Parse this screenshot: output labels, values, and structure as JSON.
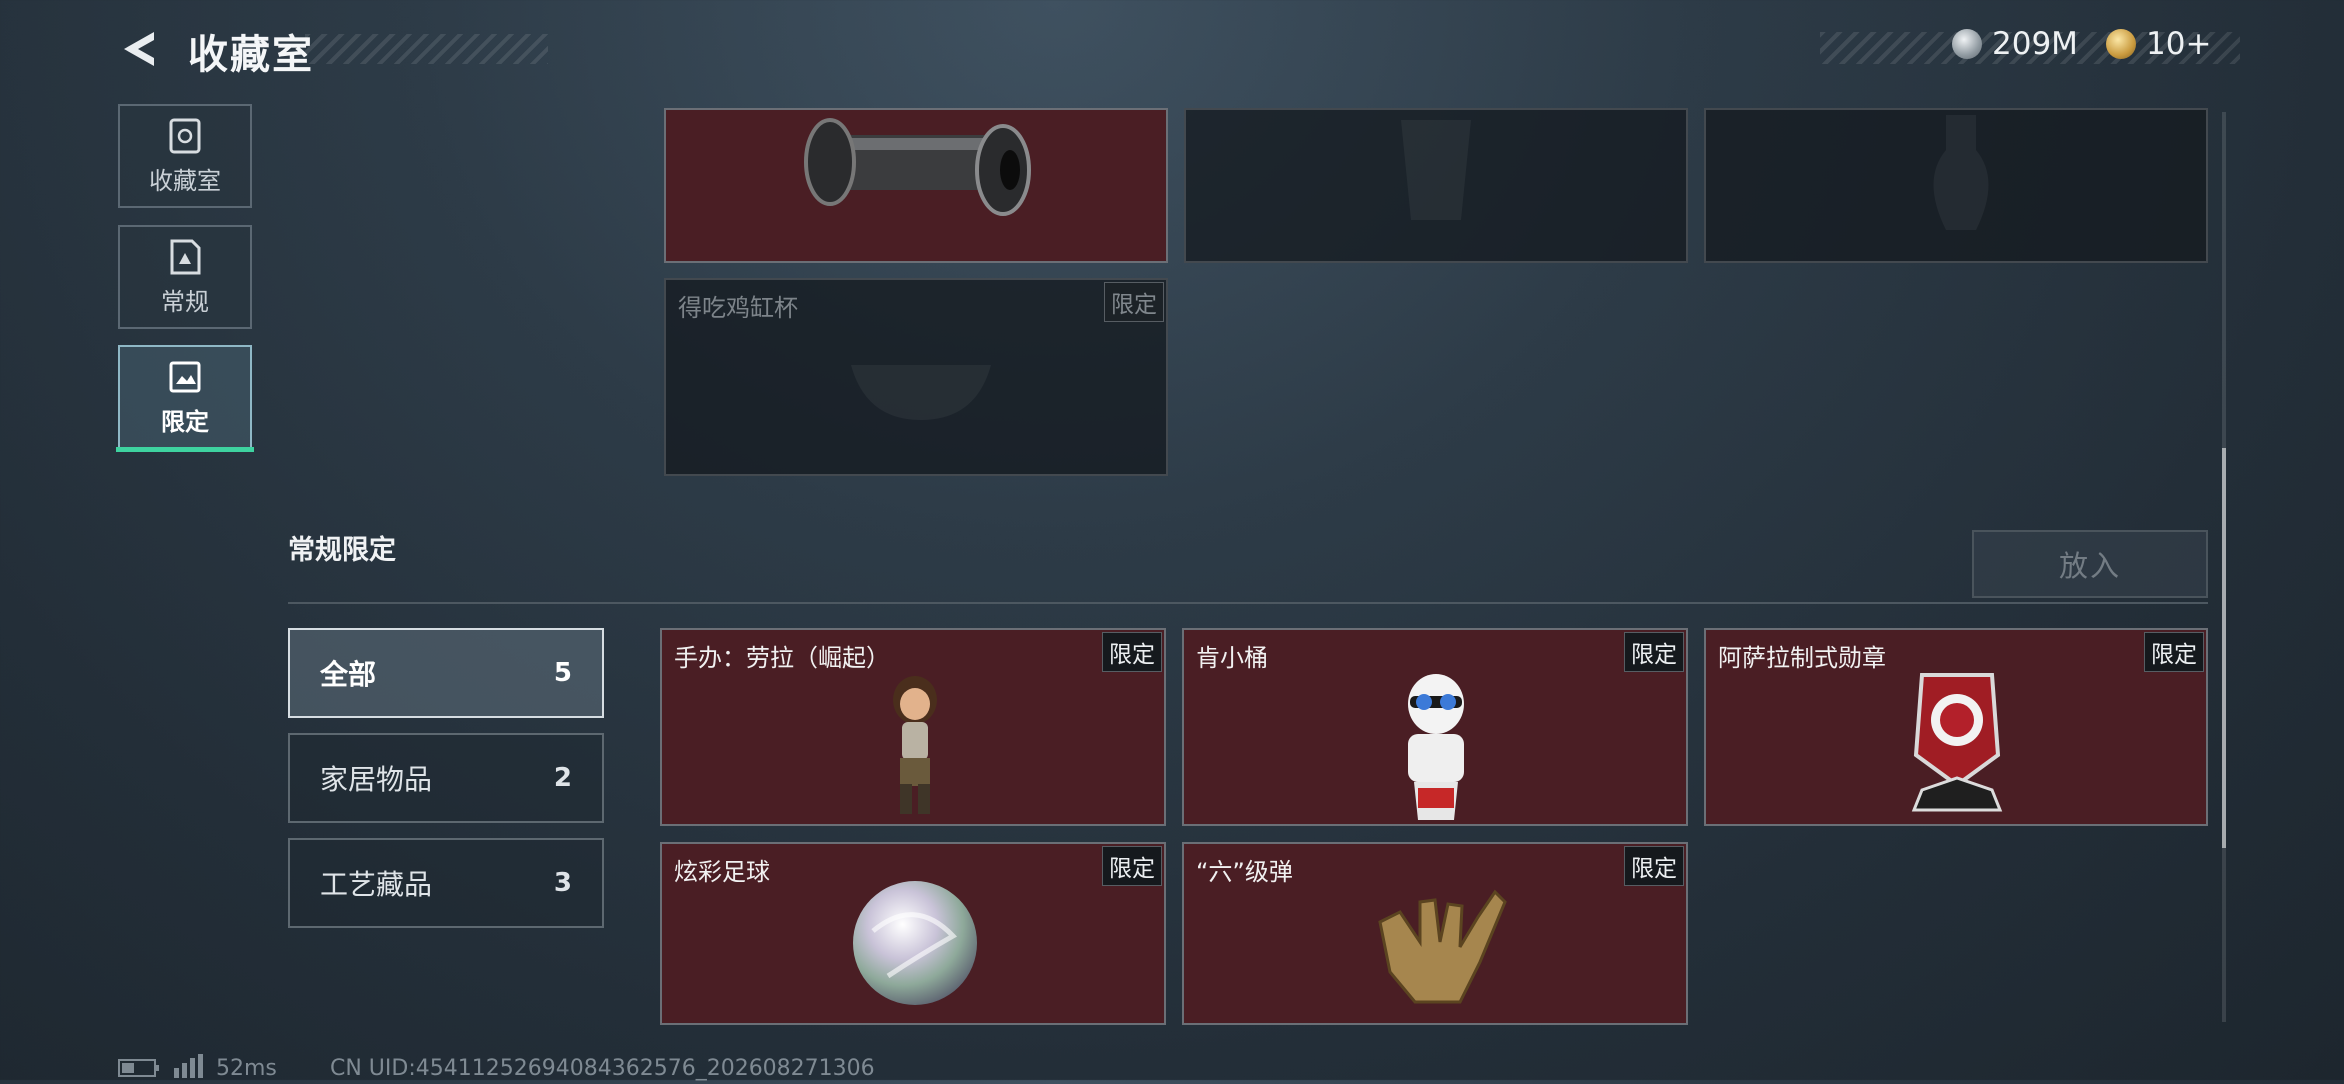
{
  "header": {
    "title": "收藏室",
    "currency": [
      {
        "icon": "silver-coin-icon",
        "amount": "209M",
        "color": "#b9c2c8"
      },
      {
        "icon": "gold-medal-icon",
        "amount": "10+",
        "color": "#d8b25b"
      }
    ]
  },
  "nav": [
    {
      "label": "收藏室",
      "icon": "vault-icon",
      "active": false
    },
    {
      "label": "常规",
      "icon": "document-icon",
      "active": false
    },
    {
      "label": "限定",
      "icon": "limited-image-icon",
      "active": true
    }
  ],
  "upper_items": [
    {
      "name": "",
      "tag": "",
      "style": "red",
      "icon": "rolling-pin-item"
    },
    {
      "name": "",
      "tag": "",
      "style": "dark",
      "icon": "bucket-item"
    },
    {
      "name": "",
      "tag": "",
      "style": "dark",
      "icon": "vase-item"
    },
    {
      "name": "得吃鸡缸杯",
      "tag": "限定",
      "style": "dark",
      "icon": "bowl-item"
    }
  ],
  "section": {
    "title": "常规限定",
    "put_button": "放入",
    "filters": [
      {
        "label": "全部",
        "count": "5",
        "active": true
      },
      {
        "label": "家居物品",
        "count": "2",
        "active": false
      },
      {
        "label": "工艺藏品",
        "count": "3",
        "active": false
      }
    ],
    "items": [
      {
        "name": "手办：劳拉（崛起）",
        "tag": "限定",
        "icon": "lara-figure-item"
      },
      {
        "name": "肯小桶",
        "tag": "限定",
        "icon": "kfc-figure-item"
      },
      {
        "name": "阿萨拉制式勋章",
        "tag": "限定",
        "icon": "medal-item"
      },
      {
        "name": "炫彩足球",
        "tag": "限定",
        "icon": "iridescent-ball-item"
      },
      {
        "name": "“六”级弹",
        "tag": "限定",
        "icon": "golden-hand-item"
      }
    ]
  },
  "footer": {
    "ping": "52ms",
    "uid": "CN UID:45411252694084362576_202608271306"
  }
}
